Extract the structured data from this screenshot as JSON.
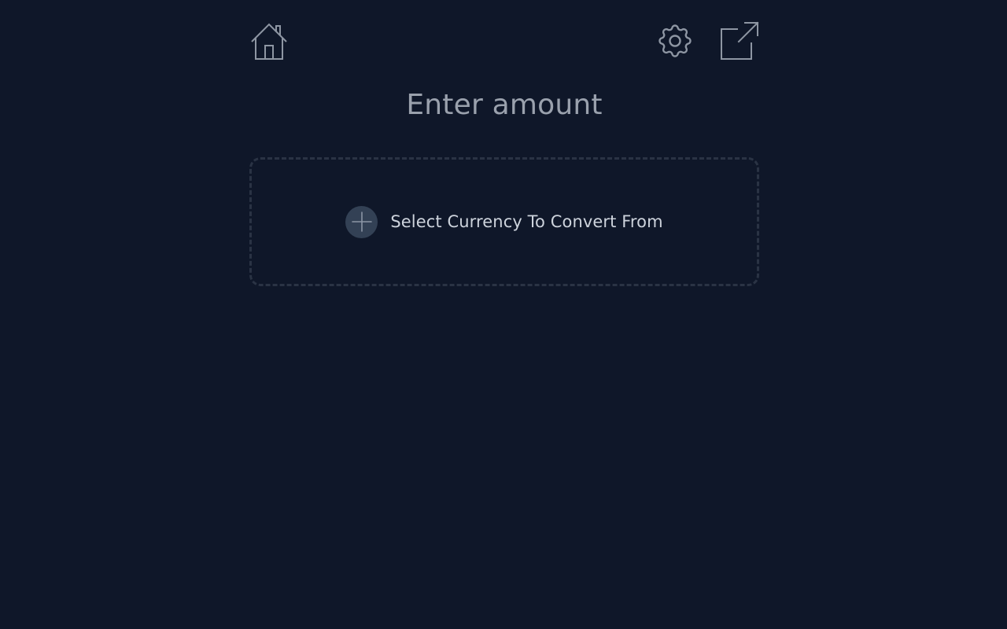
{
  "header": {
    "home_icon": "home-icon",
    "settings_icon": "gear-icon",
    "popout_icon": "external-link-icon"
  },
  "main": {
    "title": "Enter amount",
    "dropzone": {
      "icon": "plus-icon",
      "label": "Select Currency To Convert From"
    }
  },
  "colors": {
    "background": "#0f1729",
    "icon": "#8e96a3",
    "title": "#9aa1ad",
    "dashed_border": "#2a3344",
    "plus_circle": "#334155",
    "label": "#cdd3dc"
  }
}
